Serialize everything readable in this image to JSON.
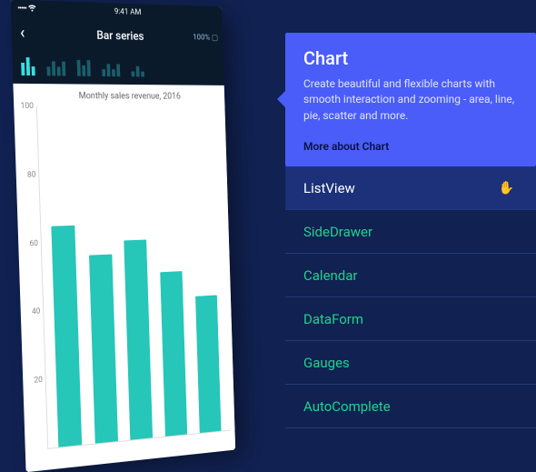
{
  "phone": {
    "status_time": "9:41 AM",
    "nav_title": "Bar series",
    "nav_right": "100% ▢",
    "chart_title": "Monthly sales revenue, 2016"
  },
  "chart_data": {
    "type": "bar",
    "title": "Monthly sales revenue, 2016",
    "ylim": [
      0,
      100
    ],
    "yticks": [
      100,
      80,
      60,
      40,
      20
    ],
    "values": [
      65,
      56,
      60,
      50,
      42
    ]
  },
  "card": {
    "title": "Chart",
    "desc": "Create beautiful and flexible charts with smooth interaction and zooming - area, line, pie, scatter and more.",
    "more": "More about Chart"
  },
  "list": {
    "items": [
      {
        "label": "ListView",
        "selected": true
      },
      {
        "label": "SideDrawer"
      },
      {
        "label": "Calendar"
      },
      {
        "label": "DataForm"
      },
      {
        "label": "Gauges"
      },
      {
        "label": "AutoComplete"
      }
    ]
  }
}
